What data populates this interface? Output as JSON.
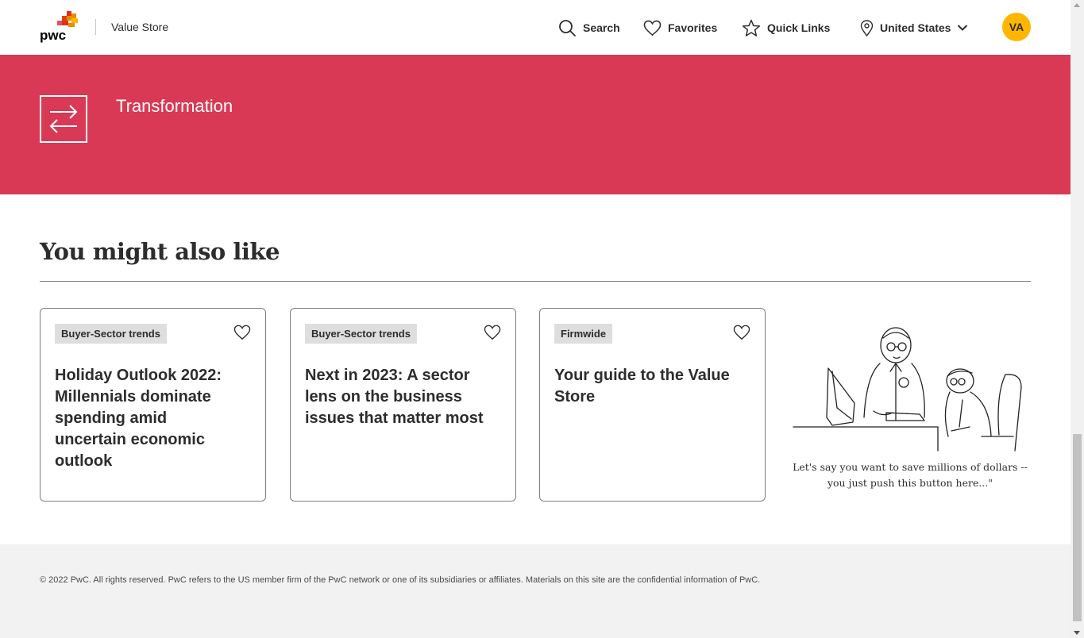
{
  "header": {
    "logo_text": "pwc",
    "store_name": "Value Store",
    "nav": {
      "search": "Search",
      "favorites": "Favorites",
      "quick_links": "Quick Links",
      "region": "United States"
    },
    "avatar_initials": "VA"
  },
  "banner": {
    "title": "Transformation",
    "color": "#d93954"
  },
  "section": {
    "title": "You might also like"
  },
  "cards": [
    {
      "tag": "Buyer-Sector trends",
      "title": "Holiday Outlook 2022: Millennials dominate spending amid uncertain economic outlook"
    },
    {
      "tag": "Buyer-Sector trends",
      "title": "Next in 2023: A sector lens on the business issues that matter most"
    },
    {
      "tag": "Firmwide",
      "title": "Your guide to the Value Store"
    }
  ],
  "cartoon": {
    "caption_line1": "Let's say you want to save millions of dollars --",
    "caption_line2": "you just push this button here...\""
  },
  "footer": {
    "copyright": "© 2022 PwC. All rights reserved. PwC refers to the US member firm of the PwC network or one of its subsidiaries or affiliates. Materials on this site are the confidential information of PwC."
  },
  "colors": {
    "accent": "#d93954",
    "avatar": "#ffb600",
    "footer_bg": "#f2f2f2"
  },
  "icons": [
    "search-icon",
    "heart-icon",
    "star-icon",
    "location-pin-icon",
    "chevron-down-icon",
    "transformation-arrows-icon"
  ]
}
